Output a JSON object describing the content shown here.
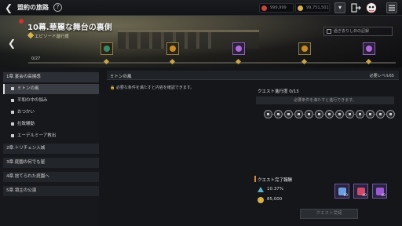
{
  "topbar": {
    "title": "盟約の旅路",
    "help_label": "?",
    "currency_1": "999,999",
    "currency_2": "99,751,501",
    "colors": {
      "currency_1": "#c9453a",
      "currency_2": "#d9b04a"
    }
  },
  "banner": {
    "title": "10幕.華麗な舞台の裏側",
    "subtitle": "エピソード進行度",
    "replay_label": "過ぎ去りし日の記録",
    "progress_label": "0/27",
    "progress_fraction": 0.0
  },
  "sidebar": {
    "chapters": [
      {
        "label": "1章.宴会の高揚感",
        "expanded": true
      },
      {
        "label": "2章.トリチェン入城"
      },
      {
        "label": "3章.庭園の何でも屋"
      },
      {
        "label": "4章.捨てられた庭園へ"
      },
      {
        "label": "5章.領主の公演"
      }
    ],
    "quests": [
      {
        "label": "ミトンの風",
        "selected": true
      },
      {
        "label": "平和の中の悩み"
      },
      {
        "label": "おつかい"
      },
      {
        "label": "拉致騒動"
      },
      {
        "label": "エーデルミーア救出"
      }
    ]
  },
  "main": {
    "quest_name": "ミトンの風",
    "required_level": "必要レベル65",
    "lock_note": "必要な条件を満たすと内容を確認できます。",
    "progress_title": "クエスト進行度 0/13",
    "requirement_banner": "必要条件を満たすと進行できます。",
    "steps_total": 13,
    "reward_title": "クエスト完了報酬",
    "reward_exp": "10.37%",
    "reward_gold": "85,000",
    "items": [
      {
        "qty": "10",
        "icon": "blue-potion-icon",
        "color": "#6aa0e0"
      },
      {
        "qty": "40",
        "icon": "red-potion-icon",
        "color": "#d04a6a"
      },
      {
        "qty": "40",
        "icon": "purple-potion-icon",
        "color": "#9a5ad0"
      }
    ],
    "claim_label": "クエスト受諾"
  }
}
